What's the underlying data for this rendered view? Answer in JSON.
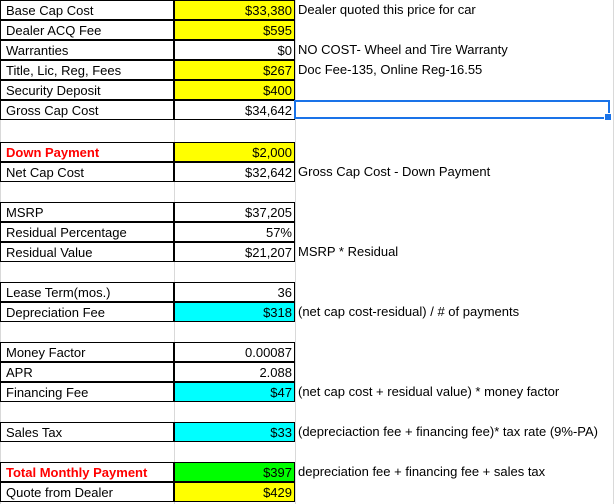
{
  "rows": [
    {
      "label": "Base Cap Cost",
      "value": "$33,380",
      "note": "Dealer quoted this price for car"
    },
    {
      "label": "Dealer ACQ Fee",
      "value": "$595",
      "note": ""
    },
    {
      "label": "Warranties",
      "value": "$0",
      "note": "NO COST- Wheel and Tire Warranty"
    },
    {
      "label": "Title, Lic, Reg, Fees",
      "value": "$267",
      "note": "Doc Fee-135, Online Reg-16.55"
    },
    {
      "label": "Security Deposit",
      "value": "$400",
      "note": ""
    },
    {
      "label": "Gross Cap Cost",
      "value": "$34,642",
      "note": ""
    },
    {
      "label": "Down Payment",
      "value": "$2,000",
      "note": ""
    },
    {
      "label": "Net Cap Cost",
      "value": "$32,642",
      "note": "Gross Cap Cost - Down Payment"
    },
    {
      "label": "MSRP",
      "value": "$37,205",
      "note": ""
    },
    {
      "label": "Residual Percentage",
      "value": "57%",
      "note": ""
    },
    {
      "label": "Residual Value",
      "value": "$21,207",
      "note": "MSRP * Residual"
    },
    {
      "label": "Lease Term(mos.)",
      "value": "36",
      "note": ""
    },
    {
      "label": "Depreciation Fee",
      "value": "$318",
      "note": "(net cap cost-residual) / # of payments"
    },
    {
      "label": "Money Factor",
      "value": "0.00087",
      "note": ""
    },
    {
      "label": "APR",
      "value": "2.088",
      "note": ""
    },
    {
      "label": "Financing Fee",
      "value": "$47",
      "note": "(net cap cost + residual value) * money factor"
    },
    {
      "label": "Sales Tax",
      "value": "$33",
      "note": "(depreciaction fee + financing fee)* tax rate (9%-PA)"
    },
    {
      "label": "Total Monthly Payment",
      "value": "$397",
      "note": "depreciation fee + financing fee + sales tax"
    },
    {
      "label": "Quote from Dealer",
      "value": "$429",
      "note": ""
    }
  ],
  "colors": {
    "yellow": "#ffff00",
    "cyan": "#00ffff",
    "green": "#00ff00",
    "red": "#ff0000",
    "selection": "#1a73e8"
  }
}
